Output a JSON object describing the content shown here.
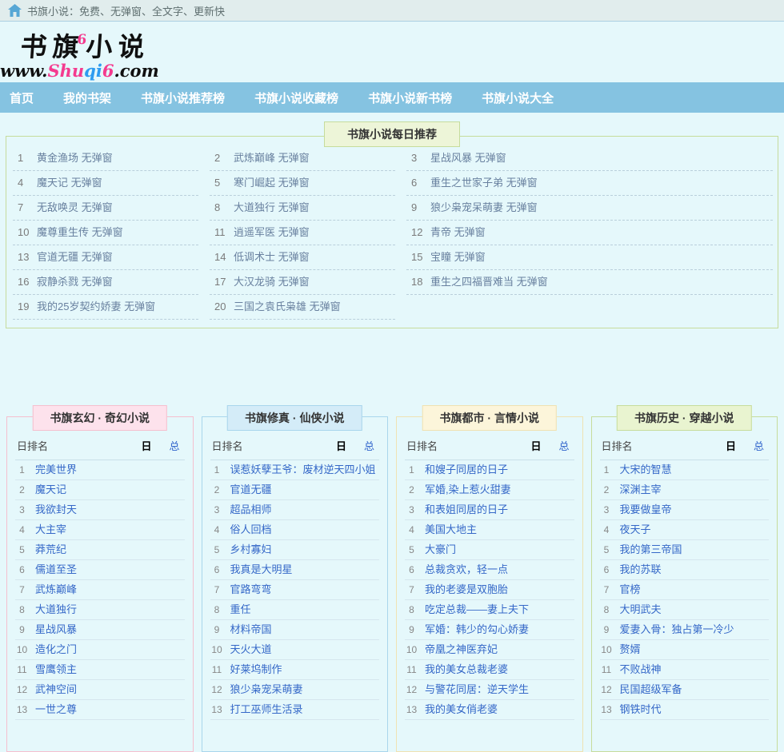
{
  "topbar": {
    "slogan": "书旗小说：免费、无弹窗、全文字、更新快",
    "icon": "home-icon"
  },
  "logo": {
    "name_part1": "书旗",
    "name_sup": "6",
    "name_part2": "小说",
    "url_www": "www.",
    "url_shu": "Shu",
    "url_qi": "qi",
    "url_6": "6",
    "url_com": ".com"
  },
  "nav": {
    "items": [
      {
        "id": "home",
        "label": "首页"
      },
      {
        "id": "bookshelf",
        "label": "我的书架"
      },
      {
        "id": "recommend-rank",
        "label": "书旗小说推荐榜"
      },
      {
        "id": "collect-rank",
        "label": "书旗小说收藏榜"
      },
      {
        "id": "new-rank",
        "label": "书旗小说新书榜"
      },
      {
        "id": "all-books",
        "label": "书旗小说大全"
      }
    ]
  },
  "daily": {
    "title": "书旗小说每日推荐",
    "suffix": "无弹窗",
    "items": [
      {
        "rank": 1,
        "title": "黄金渔场"
      },
      {
        "rank": 2,
        "title": "武炼巅峰"
      },
      {
        "rank": 3,
        "title": "星战风暴"
      },
      {
        "rank": 4,
        "title": "魔天记"
      },
      {
        "rank": 5,
        "title": "寒门崛起"
      },
      {
        "rank": 6,
        "title": "重生之世家子弟"
      },
      {
        "rank": 7,
        "title": "无敌唤灵"
      },
      {
        "rank": 8,
        "title": "大道独行"
      },
      {
        "rank": 9,
        "title": "狼少枭宠呆萌妻"
      },
      {
        "rank": 10,
        "title": "魔尊重生传"
      },
      {
        "rank": 11,
        "title": "逍遥军医"
      },
      {
        "rank": 12,
        "title": "青帝"
      },
      {
        "rank": 13,
        "title": "官道无疆"
      },
      {
        "rank": 14,
        "title": "低调术士"
      },
      {
        "rank": 15,
        "title": "宝瞳"
      },
      {
        "rank": 16,
        "title": "寂静杀戮"
      },
      {
        "rank": 17,
        "title": "大汉龙骑"
      },
      {
        "rank": 18,
        "title": "重生之四福晋难当"
      },
      {
        "rank": 19,
        "title": "我的25岁契约娇妻"
      },
      {
        "rank": 20,
        "title": "三国之袁氏枭雄"
      }
    ]
  },
  "boards": [
    {
      "title": "书旗玄幻 · 奇幻小说",
      "theme": "pink",
      "header": {
        "label": "日排名",
        "day": "日",
        "total": "总"
      },
      "items": [
        {
          "rank": 1,
          "title": "完美世界"
        },
        {
          "rank": 2,
          "title": "魔天记"
        },
        {
          "rank": 3,
          "title": "我欲封天"
        },
        {
          "rank": 4,
          "title": "大主宰"
        },
        {
          "rank": 5,
          "title": "莽荒纪"
        },
        {
          "rank": 6,
          "title": "儒道至圣"
        },
        {
          "rank": 7,
          "title": "武炼巅峰"
        },
        {
          "rank": 8,
          "title": "大道独行"
        },
        {
          "rank": 9,
          "title": "星战风暴"
        },
        {
          "rank": 10,
          "title": "造化之门"
        },
        {
          "rank": 11,
          "title": "雪鹰领主"
        },
        {
          "rank": 12,
          "title": "武神空间"
        },
        {
          "rank": 13,
          "title": "一世之尊"
        }
      ]
    },
    {
      "title": "书旗修真 · 仙侠小说",
      "theme": "blue",
      "header": {
        "label": "日排名",
        "day": "日",
        "total": "总"
      },
      "items": [
        {
          "rank": 1,
          "title": "误惹妖孽王爷：废材逆天四小姐"
        },
        {
          "rank": 2,
          "title": "官道无疆"
        },
        {
          "rank": 3,
          "title": "超品相师"
        },
        {
          "rank": 4,
          "title": "俗人回档"
        },
        {
          "rank": 5,
          "title": "乡村寡妇"
        },
        {
          "rank": 6,
          "title": "我真是大明星"
        },
        {
          "rank": 7,
          "title": "官路弯弯"
        },
        {
          "rank": 8,
          "title": "重任"
        },
        {
          "rank": 9,
          "title": "材料帝国"
        },
        {
          "rank": 10,
          "title": "天火大道"
        },
        {
          "rank": 11,
          "title": "好莱坞制作"
        },
        {
          "rank": 12,
          "title": "狼少枭宠呆萌妻"
        },
        {
          "rank": 13,
          "title": "打工巫师生活录"
        }
      ]
    },
    {
      "title": "书旗都市 · 言情小说",
      "theme": "cream",
      "header": {
        "label": "日排名",
        "day": "日",
        "total": "总"
      },
      "items": [
        {
          "rank": 1,
          "title": "和嫂子同居的日子"
        },
        {
          "rank": 2,
          "title": "军婚,染上惹火甜妻"
        },
        {
          "rank": 3,
          "title": "和表姐同居的日子"
        },
        {
          "rank": 4,
          "title": "美国大地主"
        },
        {
          "rank": 5,
          "title": "大豪门"
        },
        {
          "rank": 6,
          "title": "总裁贪欢，轻一点"
        },
        {
          "rank": 7,
          "title": "我的老婆是双胞胎"
        },
        {
          "rank": 8,
          "title": "吃定总裁——妻上夫下"
        },
        {
          "rank": 9,
          "title": "军婚：韩少的勾心娇妻"
        },
        {
          "rank": 10,
          "title": "帝凰之神医弃妃"
        },
        {
          "rank": 11,
          "title": "我的美女总裁老婆"
        },
        {
          "rank": 12,
          "title": "与警花同居：逆天学生"
        },
        {
          "rank": 13,
          "title": "我的美女俏老婆"
        }
      ]
    },
    {
      "title": "书旗历史 · 穿越小说",
      "theme": "green",
      "header": {
        "label": "日排名",
        "day": "日",
        "total": "总"
      },
      "items": [
        {
          "rank": 1,
          "title": "大宋的智慧"
        },
        {
          "rank": 2,
          "title": "深渊主宰"
        },
        {
          "rank": 3,
          "title": "我要做皇帝"
        },
        {
          "rank": 4,
          "title": "夜天子"
        },
        {
          "rank": 5,
          "title": "我的第三帝国"
        },
        {
          "rank": 6,
          "title": "我的苏联"
        },
        {
          "rank": 7,
          "title": "官榜"
        },
        {
          "rank": 8,
          "title": "大明武夫"
        },
        {
          "rank": 9,
          "title": "爱妻入骨：独占第一冷少"
        },
        {
          "rank": 10,
          "title": "赘婿"
        },
        {
          "rank": 11,
          "title": "不败战神"
        },
        {
          "rank": 12,
          "title": "民国超级军备"
        },
        {
          "rank": 13,
          "title": "钢铁时代"
        }
      ]
    }
  ],
  "colors": {
    "page_bg": "#e5f8fb",
    "topbar_bg": "#e1eded",
    "nav_bg": "#85c3e1",
    "green_border": "#c6dc9c",
    "daily_link": "#68809f",
    "board_link": "#3568c8",
    "logo_pink": "#f43b8f",
    "logo_blue": "#2e9cf0",
    "theme_pink_bg": "#fde2ec",
    "theme_pink_border": "#f5bfce",
    "theme_blue_bg": "#d4ecf8",
    "theme_blue_border": "#a9d6ec",
    "theme_cream_bg": "#fcf5da",
    "theme_cream_border": "#efe2b2",
    "theme_green_bg": "#e9f4d0",
    "theme_green_border": "#c6dc9c"
  }
}
